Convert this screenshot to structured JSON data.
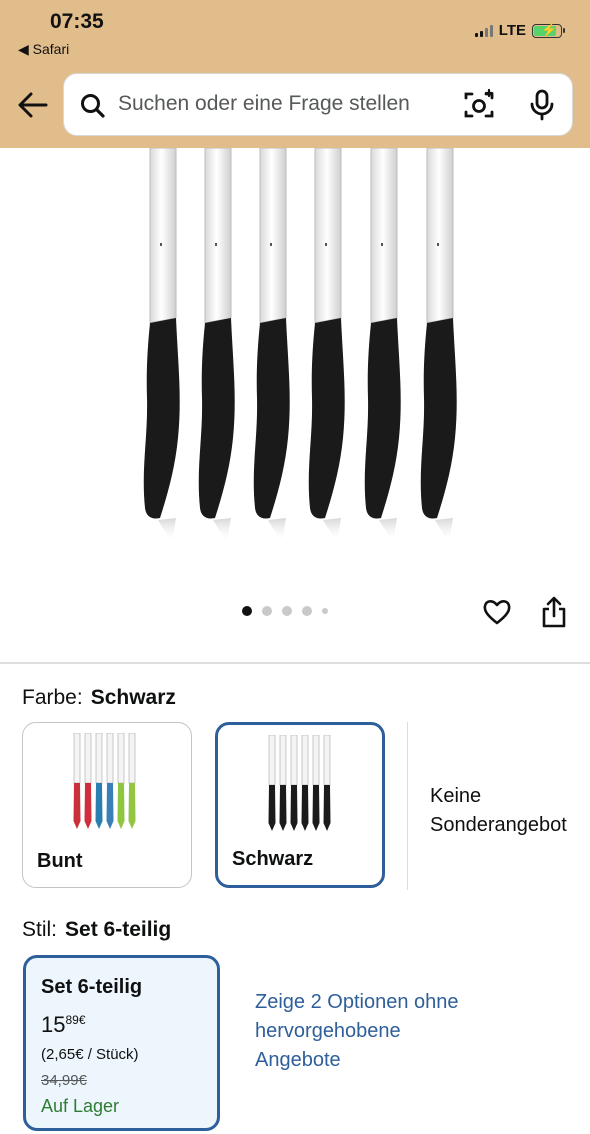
{
  "status_bar": {
    "time": "07:35",
    "back_app": "◀ Safari",
    "network": "LTE"
  },
  "search": {
    "placeholder": "Suchen oder eine Frage stellen"
  },
  "carousel": {
    "total": 5,
    "active": 1
  },
  "color": {
    "label": "Farbe:",
    "selected": "Schwarz",
    "options": [
      {
        "label": "Bunt",
        "selected": false,
        "handle_colors": [
          "#c9303a",
          "#cf2f3c",
          "#2b7fb0",
          "#3a7fb8",
          "#8dc63f",
          "#92c642"
        ]
      },
      {
        "label": "Schwarz",
        "selected": true,
        "handle_colors": [
          "#1b1b1b",
          "#1b1b1b",
          "#1b1b1b",
          "#1b1b1b",
          "#1b1b1b",
          "#1b1b1b"
        ]
      }
    ],
    "no_offers_line1": "Keine",
    "no_offers_line2": "Sonderangebot"
  },
  "style": {
    "label": "Stil:",
    "selected": "Set 6-teilig",
    "card": {
      "title": "Set 6-teilig",
      "price_whole": "15",
      "price_fraction": "89",
      "currency": "€",
      "unit_price": "(2,65€ / Stück)",
      "old_price": "34,99€",
      "stock": "Auf Lager"
    },
    "more_options": "Zeige 2 Optionen ohne hervorgehobene Angebote"
  },
  "colors": {
    "header_bg": "#e2bd8c",
    "accent": "#2f5f9a",
    "stock": "#2e7d32",
    "selected_bg": "#edf5fd"
  }
}
